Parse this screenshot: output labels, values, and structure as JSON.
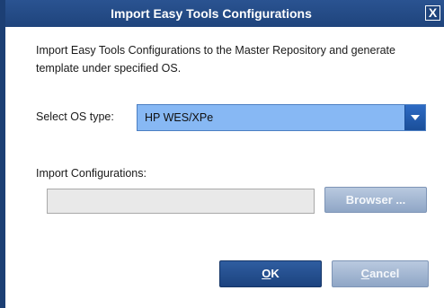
{
  "dialog": {
    "title": "Import Easy Tools Configurations",
    "close_label": "X",
    "description": "Import Easy Tools Configurations to the Master Repository and generate template under specified OS."
  },
  "os_type": {
    "label": "Select OS type:",
    "selected": "HP WES/XPe"
  },
  "import_config": {
    "label": "Import Configurations:",
    "value": "",
    "browse_label": "Browser ..."
  },
  "actions": {
    "ok_mnemonic": "O",
    "ok_rest": "K",
    "cancel_mnemonic": "C",
    "cancel_rest": "ancel"
  },
  "colors": {
    "titlebar": "#1f447c",
    "select_bg": "#87b8f4",
    "primary_button": "#1c437f",
    "secondary_button": "#8fa6c6"
  }
}
